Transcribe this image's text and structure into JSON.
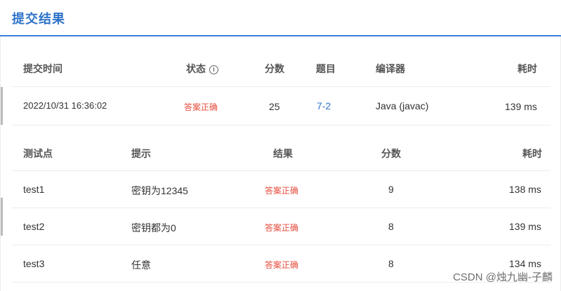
{
  "header": {
    "title": "提交结果"
  },
  "submission": {
    "headers": {
      "time": "提交时间",
      "status": "状态",
      "status_icon": "info-icon",
      "score": "分数",
      "problem": "题目",
      "compiler": "编译器",
      "elapsed": "耗时"
    },
    "row": {
      "time": "2022/10/31 16:36:02",
      "status": "答案正确",
      "score": "25",
      "problem": "7-2",
      "compiler": "Java (javac)",
      "elapsed": "139 ms"
    }
  },
  "tests": {
    "headers": {
      "point": "测试点",
      "hint": "提示",
      "result": "结果",
      "score": "分数",
      "elapsed": "耗时"
    },
    "rows": [
      {
        "point": "test1",
        "hint": "密钥为12345",
        "result": "答案正确",
        "score": "9",
        "elapsed": "138 ms"
      },
      {
        "point": "test2",
        "hint": "密钥都为0",
        "result": "答案正确",
        "score": "8",
        "elapsed": "139 ms"
      },
      {
        "point": "test3",
        "hint": "任意",
        "result": "答案正确",
        "score": "8",
        "elapsed": "134 ms"
      }
    ]
  },
  "watermark": "CSDN @烛九幽-子麟",
  "colors": {
    "accent": "#2f74c8",
    "success": "#e74c3c",
    "divider": "#ececec"
  }
}
